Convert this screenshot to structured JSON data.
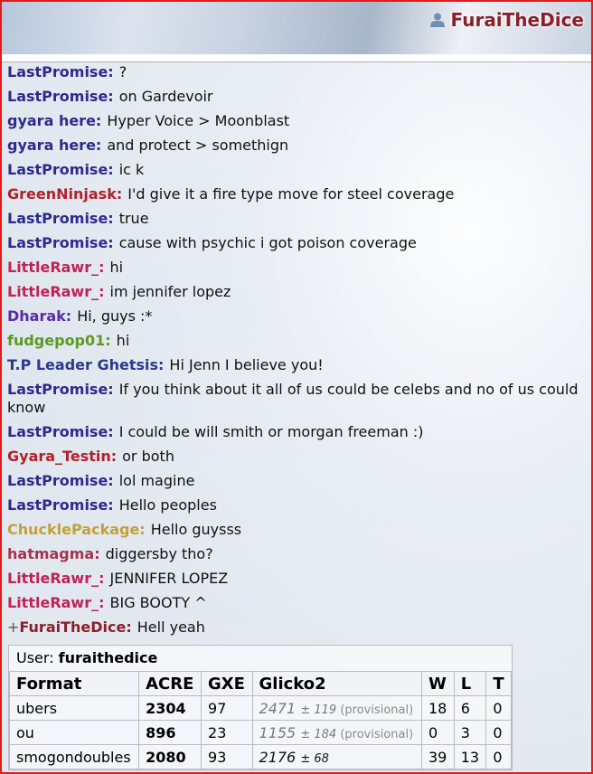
{
  "header": {
    "username": "FuraiTheDice"
  },
  "chat": [
    {
      "user": "LastPromise:",
      "text": "?",
      "color": "#2b2b8e"
    },
    {
      "user": "LastPromise:",
      "text": "on Gardevoir",
      "color": "#2b2b8e"
    },
    {
      "user": "gyara here:",
      "text": "Hyper Voice > Moonblast",
      "color": "#2b2b8e"
    },
    {
      "user": "gyara here:",
      "text": "and protect > somethign",
      "color": "#2b2b8e"
    },
    {
      "user": "LastPromise:",
      "text": "ic k",
      "color": "#2b2b8e"
    },
    {
      "user": "GreenNinjask:",
      "text": "I'd give it a fire type move for steel coverage",
      "color": "#b3202a"
    },
    {
      "user": "LastPromise:",
      "text": "true",
      "color": "#2b2b8e"
    },
    {
      "user": "LastPromise:",
      "text": "cause with psychic i got poison coverage",
      "color": "#2b2b8e"
    },
    {
      "user": "LittleRawr_:",
      "text": "hi",
      "color": "#c02356"
    },
    {
      "user": "LittleRawr_:",
      "text": "im jennifer lopez",
      "color": "#c02356"
    },
    {
      "user": "Dharak:",
      "text": "Hi, guys :*",
      "color": "#5b2aa8"
    },
    {
      "user": "fudgepop01:",
      "text": "hi",
      "color": "#5d9a1f"
    },
    {
      "user": "T.P Leader Ghetsis:",
      "text": "Hi Jenn I believe you!",
      "color": "#2b3a8e"
    },
    {
      "user": "LastPromise:",
      "text": "If you think about it all of us could be celebs and no of us could know",
      "color": "#2b2b8e",
      "wrap": true
    },
    {
      "user": "LastPromise:",
      "text": "I could be will smith or morgan freeman :)",
      "color": "#2b2b8e"
    },
    {
      "user": "Gyara_Testin:",
      "text": "or both",
      "color": "#b3202a"
    },
    {
      "user": "LastPromise:",
      "text": "lol magine",
      "color": "#2b2b8e"
    },
    {
      "user": "LastPromise:",
      "text": "Hello peoples",
      "color": "#2b2b8e"
    },
    {
      "user": "ChucklePackage:",
      "text": "Hello guysss",
      "color": "#c2a13a"
    },
    {
      "user": "hatmagma:",
      "text": "diggersby tho?",
      "color": "#a8324a"
    },
    {
      "user": "LittleRawr_:",
      "text": "JENNIFER LOPEZ",
      "color": "#c02356"
    },
    {
      "user": "LittleRawr_:",
      "text": "BIG BOOTY ^",
      "color": "#c02356"
    },
    {
      "user": "FuraiTheDice:",
      "rank": "+",
      "text": "Hell yeah",
      "color": "#8b1f2a"
    }
  ],
  "stats": {
    "user_label": "User:",
    "user_value": "furaithedice",
    "headers": [
      "Format",
      "ACRE",
      "GXE",
      "Glicko2",
      "W",
      "L",
      "T"
    ],
    "rows": [
      {
        "format": "ubers",
        "acre": "2304",
        "gxe": "97",
        "glicko": "2471",
        "pm": "± 119",
        "prov": "(provisional)",
        "w": "18",
        "l": "6",
        "t": "0"
      },
      {
        "format": "ou",
        "acre": "896",
        "gxe": "23",
        "glicko": "1155",
        "pm": "± 184",
        "prov": "(provisional)",
        "w": "0",
        "l": "3",
        "t": "0"
      },
      {
        "format": "smogondoubles",
        "acre": "2080",
        "gxe": "93",
        "glicko": "2176",
        "pm": "± 68",
        "prov": "",
        "w": "39",
        "l": "13",
        "t": "0"
      }
    ]
  }
}
